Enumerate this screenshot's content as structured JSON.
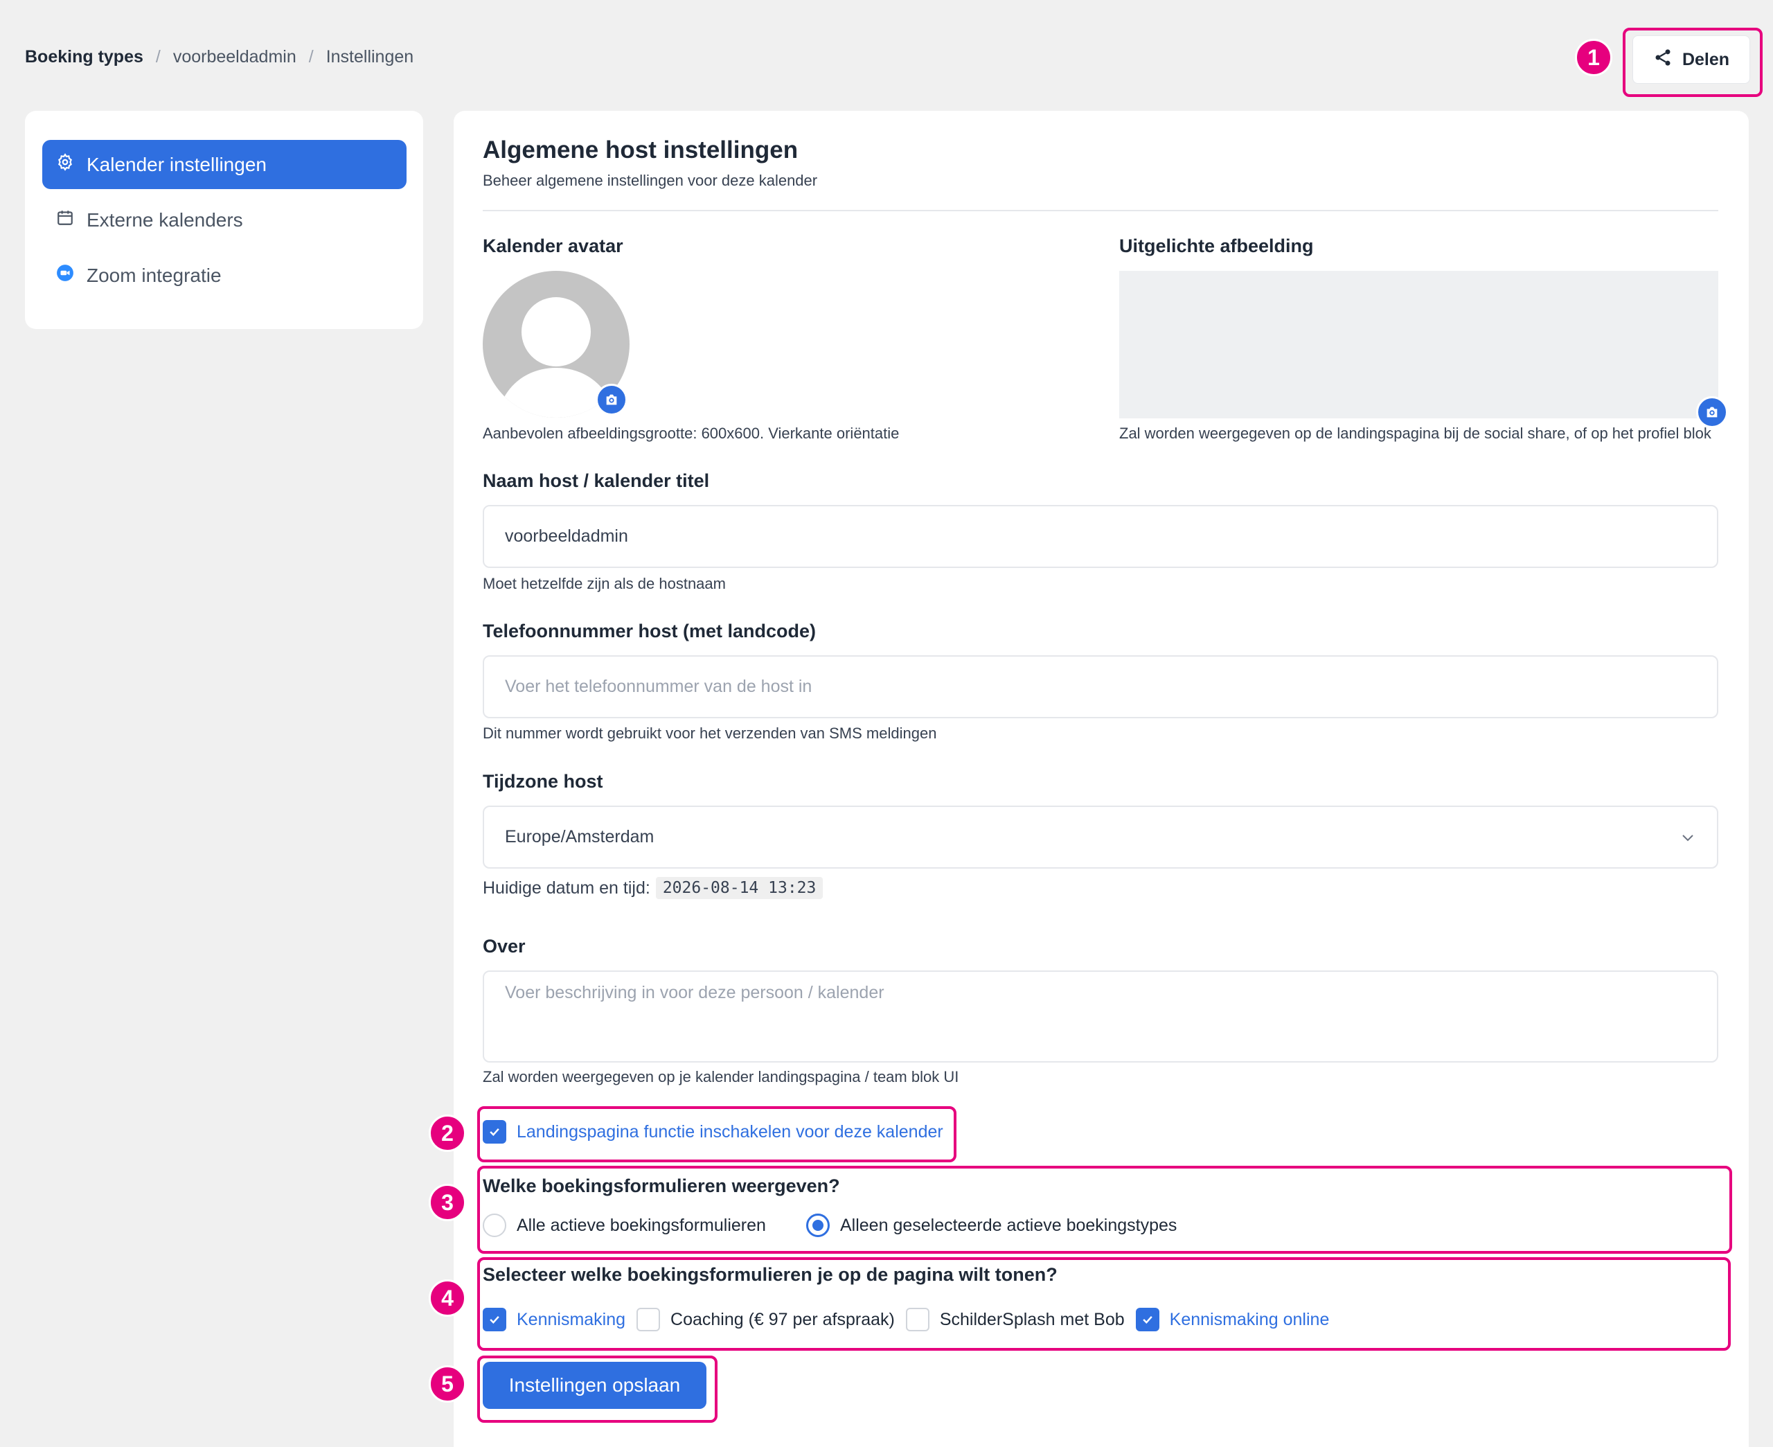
{
  "breadcrumb": [
    "Boeking types",
    "voorbeeldadmin",
    "Instellingen"
  ],
  "share_label": "Delen",
  "annotations": [
    "1",
    "2",
    "3",
    "4",
    "5"
  ],
  "sidebar": {
    "items": [
      {
        "label": "Kalender instellingen",
        "icon": "gear-icon",
        "active": true
      },
      {
        "label": "Externe kalenders",
        "icon": "calendar-icon",
        "active": false
      },
      {
        "label": "Zoom integratie",
        "icon": "zoom-icon",
        "active": false
      }
    ]
  },
  "main": {
    "title": "Algemene host instellingen",
    "subtitle": "Beheer algemene instellingen voor deze kalender",
    "avatar": {
      "label": "Kalender avatar",
      "help": "Aanbevolen afbeeldingsgrootte: 600x600. Vierkante oriëntatie"
    },
    "featured": {
      "label": "Uitgelichte afbeelding",
      "help": "Zal worden weergegeven op de landingspagina bij de social share, of op het profiel blok"
    },
    "name": {
      "label": "Naam host / kalender titel",
      "value": "voorbeeldadmin",
      "help": "Moet hetzelfde zijn als de hostnaam"
    },
    "phone": {
      "label": "Telefoonnummer host (met landcode)",
      "placeholder": "Voer het telefoonnummer van de host in",
      "help": "Dit nummer wordt gebruikt voor het verzenden van SMS meldingen"
    },
    "timezone": {
      "label": "Tijdzone host",
      "value": "Europe/Amsterdam",
      "current_label": "Huidige datum en tijd:",
      "current_value": "2026-08-14 13:23"
    },
    "about": {
      "label": "Over",
      "placeholder": "Voer beschrijving in voor deze persoon / kalender",
      "help": "Zal worden weergegeven op je kalender landingspagina / team blok UI"
    },
    "landing_checkbox": {
      "label": "Landingspagina functie inschakelen voor deze kalender",
      "checked": true
    },
    "forms_question": {
      "label": "Welke boekingsformulieren weergeven?",
      "options": [
        {
          "label": "Alle actieve boekingsformulieren",
          "selected": false
        },
        {
          "label": "Alleen geselecteerde actieve boekingstypes",
          "selected": true
        }
      ]
    },
    "select_forms": {
      "label": "Selecteer welke boekingsformulieren je op de pagina wilt tonen?",
      "options": [
        {
          "label": "Kennismaking",
          "checked": true
        },
        {
          "label": "Coaching (€ 97 per afspraak)",
          "checked": false
        },
        {
          "label": "SchilderSplash met Bob",
          "checked": false
        },
        {
          "label": "Kennismaking online",
          "checked": true
        }
      ]
    },
    "save_label": "Instellingen opslaan"
  },
  "colors": {
    "accent": "#2f6fe0",
    "annotation": "#e6007e",
    "background": "#f0f0f0"
  }
}
